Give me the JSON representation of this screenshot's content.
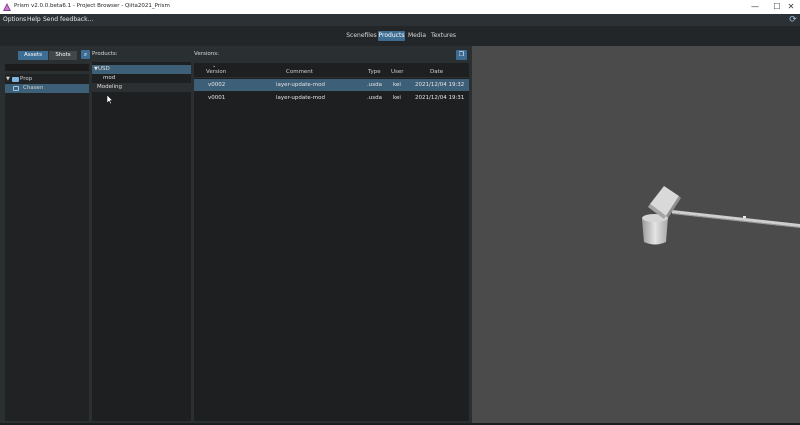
{
  "window": {
    "title": "Prism v2.0.0.beta6.1 - Project Browser - Qiita2021_Prism",
    "minimize": "—",
    "maximize": "☐",
    "close": "✕"
  },
  "menu": {
    "items": [
      "Options",
      "Help",
      "Send feedback..."
    ],
    "refresh_icon": "⟳"
  },
  "tabs": [
    {
      "label": "Scenefiles",
      "active": false
    },
    {
      "label": "Products",
      "active": true
    },
    {
      "label": "Media",
      "active": false
    },
    {
      "label": "Textures",
      "active": false
    }
  ],
  "assets": {
    "tab_assets": "Assets",
    "tab_shots": "Shots",
    "search_icon": "⌕",
    "tree": [
      {
        "label": "Prop",
        "arrow": "▼"
      },
      {
        "label": "Chasen"
      }
    ]
  },
  "products": {
    "label": "Products:",
    "arrow": "▼",
    "items": [
      "USD",
      "mod",
      "Modeling"
    ]
  },
  "versions": {
    "label": "Versions:",
    "button_icon": "❐",
    "sort_indicator": "⌄",
    "columns": [
      "Version",
      "Comment",
      "Type",
      "User",
      "Date"
    ],
    "rows": [
      {
        "version": "v0002",
        "comment": "layer-update-mod",
        "type": ".usda",
        "user": "kei",
        "date": "2021/12/04 19:32"
      },
      {
        "version": "v0001",
        "comment": "layer-update-mod",
        "type": ".usda",
        "user": "kei",
        "date": "2021/12/04 19:31"
      }
    ]
  },
  "colors": {
    "accent": "#3e6d93",
    "selection": "#3e5f78",
    "viewport": "#4b4b4b"
  }
}
